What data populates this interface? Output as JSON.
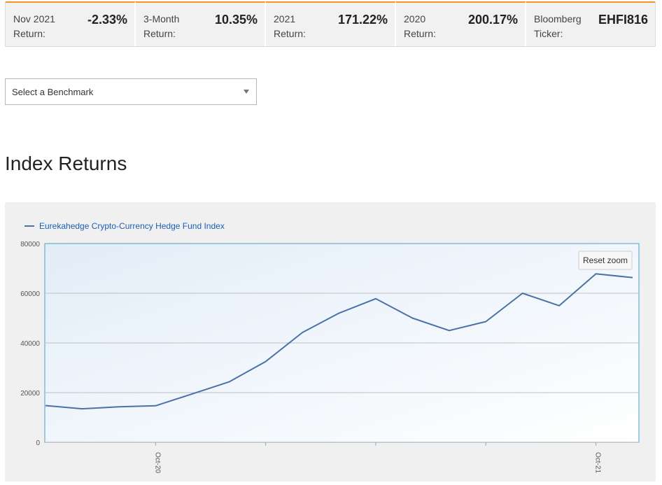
{
  "stats": [
    {
      "label": "Nov 2021 Return:",
      "value": "-2.33%"
    },
    {
      "label": "3-Month Return:",
      "value": "10.35%"
    },
    {
      "label": "2021 Return:",
      "value": "171.22%"
    },
    {
      "label": "2020 Return:",
      "value": "200.17%"
    },
    {
      "label": "Bloomberg Ticker:",
      "value": "EHFI816"
    }
  ],
  "benchmark": {
    "placeholder": "Select a Benchmark"
  },
  "section": {
    "title": "Index Returns"
  },
  "chart_buttons": {
    "reset_zoom": "Reset zoom"
  },
  "colors": {
    "accent": "#f7931e",
    "line": "#4a72a6",
    "legend_text": "#1a5fb4"
  },
  "chart_data": {
    "type": "line",
    "legend_position": "top-left",
    "grid": true,
    "ylim": [
      0,
      80000
    ],
    "y_ticks": [
      0,
      20000,
      40000,
      60000,
      80000
    ],
    "x_tick_labels": [
      "Oct-20",
      "Oct-21"
    ],
    "series": [
      {
        "name": "Eurekahedge Crypto-Currency Hedge Fund Index",
        "x": [
          "Jul-20",
          "Aug-20",
          "Sep-20",
          "Oct-20",
          "Nov-20",
          "Dec-20",
          "Jan-21",
          "Feb-21",
          "Mar-21",
          "Apr-21",
          "May-21",
          "Jun-21",
          "Jul-21",
          "Aug-21",
          "Sep-21",
          "Oct-21",
          "Nov-21"
        ],
        "values": [
          14800,
          13500,
          14300,
          14700,
          19500,
          24300,
          32500,
          44200,
          52000,
          57800,
          50000,
          45000,
          48600,
          60000,
          55000,
          67800,
          66300
        ]
      }
    ]
  }
}
